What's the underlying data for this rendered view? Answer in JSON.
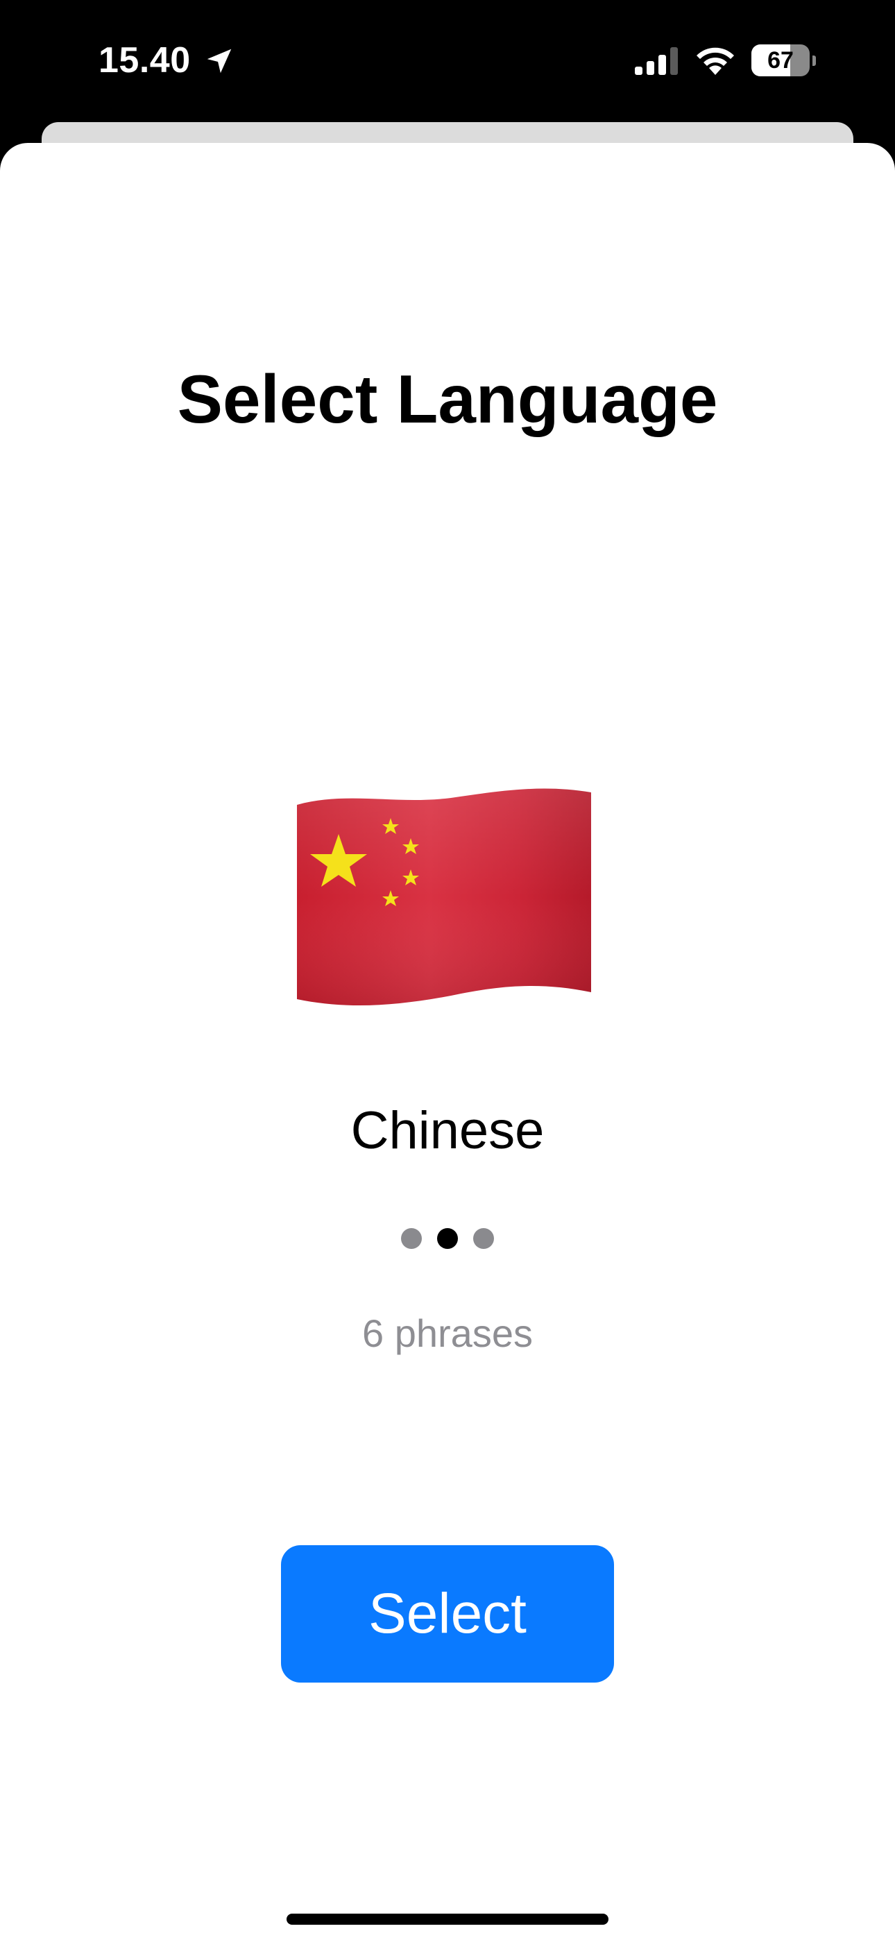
{
  "status_bar": {
    "time": "15.40",
    "battery_level": "67",
    "battery_fraction": 0.67,
    "icons": [
      "location-arrow-icon",
      "cellular-signal-icon",
      "wifi-icon",
      "battery-icon"
    ]
  },
  "page": {
    "title": "Select Language"
  },
  "language": {
    "flag_icon": "china-flag-icon",
    "name": "Chinese",
    "phrases": "6 phrases"
  },
  "pager": {
    "count": 3,
    "active_index": 1
  },
  "actions": {
    "select_label": "Select"
  },
  "colors": {
    "accent": "#0a7aff",
    "flag_red": "#d12a38",
    "flag_star": "#f5e11b",
    "secondary_text": "#8e8e93"
  }
}
